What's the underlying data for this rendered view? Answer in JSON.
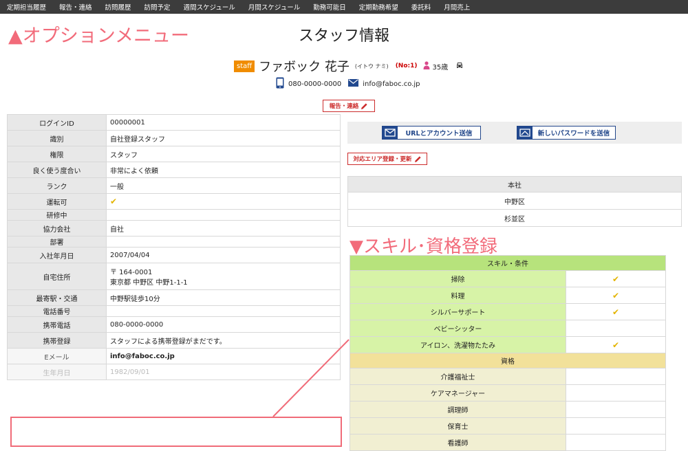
{
  "nav": {
    "items": [
      "定期担当履歴",
      "報告・連絡",
      "訪問履歴",
      "訪問予定",
      "週間スケジュール",
      "月間スケジュール",
      "勤務可能日",
      "定期勤務希望",
      "委託料",
      "月間売上"
    ]
  },
  "annotations": {
    "option_menu": "▲オプションメニュー",
    "skill": "▼スキル･資格登録"
  },
  "page": {
    "title": "スタッフ情報"
  },
  "staff": {
    "badge": "staff",
    "name": "ファボック 花子",
    "kana": "(イトウ ナミ)",
    "number": "(No:1)",
    "age": "35歳",
    "phone": "080-0000-0000",
    "email": "info@faboc.co.jp"
  },
  "buttons": {
    "report": "報告・連絡",
    "send_url": "URLとアカウント送信",
    "send_password": "新しいパスワードを送信",
    "area_update": "対応エリア登録・更新"
  },
  "details": [
    {
      "key": "ログインID",
      "value": "00000001"
    },
    {
      "key": "識別",
      "value": "自社登録スタッフ"
    },
    {
      "key": "権限",
      "value": "スタッフ"
    },
    {
      "key": "良く使う度合い",
      "value": "非常によく依頼"
    },
    {
      "key": "ランク",
      "value": "一般"
    },
    {
      "key": "運転可",
      "value": "✔"
    },
    {
      "key": "研修中",
      "value": ""
    },
    {
      "key": "協力会社",
      "value": "自社"
    },
    {
      "key": "部署",
      "value": ""
    },
    {
      "key": "入社年月日",
      "value": "2007/04/04"
    },
    {
      "key": "自宅住所",
      "value": "〒 164-0001",
      "value2": "東京都 中野区 中野1-1-1"
    },
    {
      "key": "最寄駅・交通",
      "value": "中野駅徒歩10分"
    },
    {
      "key": "電話番号",
      "value": ""
    },
    {
      "key": "携帯電話",
      "value": "080-0000-0000"
    },
    {
      "key": "携帯登録",
      "value": "スタッフによる携帯登録がまだです。"
    },
    {
      "key": "Eメール",
      "value": "info@faboc.co.jp"
    },
    {
      "key": "生年月日",
      "value": "1982/09/01"
    }
  ],
  "areas": {
    "header": "本社",
    "items": [
      "中野区",
      "杉並区"
    ]
  },
  "skills": {
    "header": "スキル・条件",
    "items": [
      {
        "label": "掃除",
        "value": "✔"
      },
      {
        "label": "料理",
        "value": "✔"
      },
      {
        "label": "シルバーサポート",
        "value": "✔"
      },
      {
        "label": "ベビーシッター",
        "value": ""
      },
      {
        "label": "アイロン、洗濯物たたみ",
        "value": "✔"
      }
    ]
  },
  "qualifications": {
    "header": "資格",
    "items": [
      "介護福祉士",
      "ケアマネージャー",
      "調理師",
      "保育士",
      "看護師"
    ]
  },
  "colors": {
    "nav_bg": "#3c3c3c",
    "annotation": "#f26b7a",
    "accent_orange": "#f08c00",
    "red": "#cc2b2b",
    "blue": "#21468a",
    "skill_header": "#b7e37c",
    "qualification_header": "#f2e19a"
  }
}
